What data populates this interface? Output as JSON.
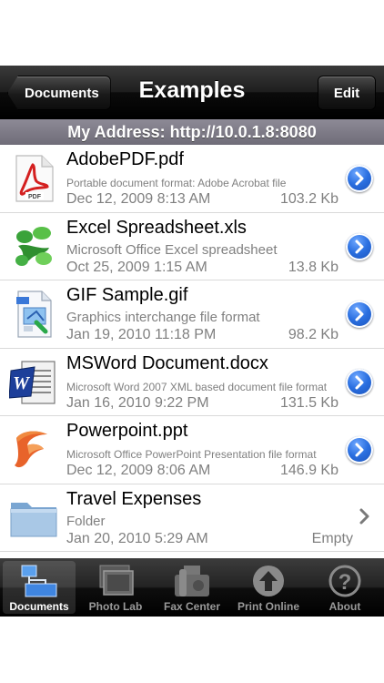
{
  "navbar": {
    "back_label": "Documents",
    "title": "Examples",
    "edit_label": "Edit"
  },
  "address": "My Address: http://10.0.1.8:8080",
  "files": [
    {
      "name": "AdobePDF.pdf",
      "description": "Portable document format: Adobe Acrobat file",
      "date": "Dec 12, 2009 8:13 AM",
      "size": "103.2 Kb",
      "icon": "pdf-icon",
      "accessory": "detail-disclosure"
    },
    {
      "name": "Excel Spreadsheet.xls",
      "description": "Microsoft Office Excel spreadsheet",
      "date": "Oct 25, 2009 1:15 AM",
      "size": "13.8 Kb",
      "icon": "excel-icon",
      "accessory": "detail-disclosure"
    },
    {
      "name": "GIF Sample.gif",
      "description": "Graphics interchange file format",
      "date": "Jan 19, 2010 11:18 PM",
      "size": "98.2 Kb",
      "icon": "gif-image-icon",
      "accessory": "detail-disclosure"
    },
    {
      "name": "MSWord Document.docx",
      "description": "Microsoft Word 2007 XML based document file format",
      "date": "Jan 16, 2010 9:22 PM",
      "size": "131.5 Kb",
      "icon": "word-icon",
      "accessory": "detail-disclosure"
    },
    {
      "name": "Powerpoint.ppt",
      "description": "Microsoft Office PowerPoint Presentation file format",
      "date": "Dec 12, 2009 8:06 AM",
      "size": "146.9 Kb",
      "icon": "powerpoint-icon",
      "accessory": "detail-disclosure"
    },
    {
      "name": "Travel Expenses",
      "description": "Folder",
      "date": "Jan 20, 2010 5:29 AM",
      "size": "Empty",
      "icon": "folder-icon",
      "accessory": "chevron"
    }
  ],
  "tabs": [
    {
      "label": "Documents",
      "icon": "documents-icon",
      "selected": true
    },
    {
      "label": "Photo Lab",
      "icon": "photo-lab-icon",
      "selected": false
    },
    {
      "label": "Fax Center",
      "icon": "fax-icon",
      "selected": false
    },
    {
      "label": "Print Online",
      "icon": "upload-icon",
      "selected": false
    },
    {
      "label": "About",
      "icon": "question-icon",
      "selected": false
    }
  ],
  "colors": {
    "accent_blue": "#2a6fe0",
    "address_bar": "#7d7a86",
    "secondary_text": "#808080"
  }
}
